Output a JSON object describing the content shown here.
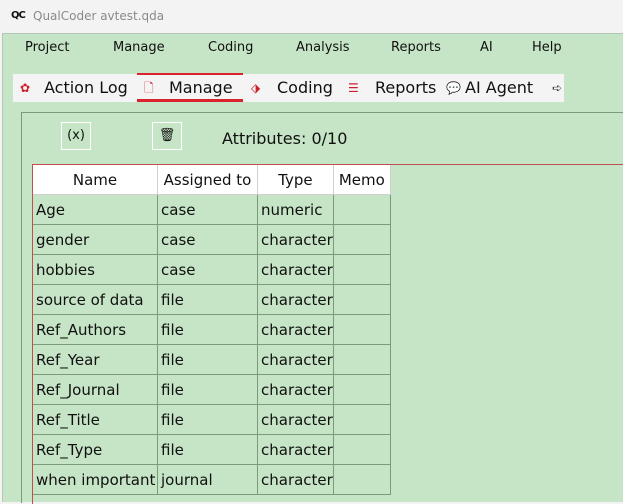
{
  "window": {
    "title": "QualCoder avtest.qda",
    "app_icon_text": "QC"
  },
  "menubar": [
    "Project",
    "Manage",
    "Coding",
    "Analysis",
    "Reports",
    "AI",
    "Help"
  ],
  "tabs": [
    {
      "label": "Action Log",
      "icon": "gear-icon",
      "glyph": "✿",
      "active": false
    },
    {
      "label": "Manage",
      "icon": "document-icon",
      "glyph": "🗋",
      "active": true
    },
    {
      "label": "Coding",
      "icon": "tag-icon",
      "glyph": "⬗",
      "active": false
    },
    {
      "label": "Reports",
      "icon": "report-list-icon",
      "glyph": "☰",
      "active": false
    },
    {
      "label": "AI Agent",
      "icon": "chat-icon",
      "glyph": "💬",
      "active": false
    }
  ],
  "tab_scroll_glyph": "➪",
  "toolbar": {
    "variable_button_text": "(x)",
    "delete_button_glyph": "🗑",
    "attributes_label": "Attributes: 0/10"
  },
  "table": {
    "columns": [
      "Name",
      "Assigned to",
      "Type",
      "Memo"
    ],
    "rows": [
      [
        "Age",
        "case",
        "numeric",
        ""
      ],
      [
        "gender",
        "case",
        "character",
        ""
      ],
      [
        "hobbies",
        "case",
        "character",
        ""
      ],
      [
        "source of data",
        "file",
        "character",
        ""
      ],
      [
        "Ref_Authors",
        "file",
        "character",
        ""
      ],
      [
        "Ref_Year",
        "file",
        "character",
        ""
      ],
      [
        "Ref_Journal",
        "file",
        "character",
        ""
      ],
      [
        "Ref_Title",
        "file",
        "character",
        ""
      ],
      [
        "Ref_Type",
        "file",
        "character",
        ""
      ],
      [
        "when important",
        "journal",
        "character",
        ""
      ]
    ]
  },
  "colors": {
    "background": "#c6e4c6",
    "accent": "#d9232e"
  }
}
